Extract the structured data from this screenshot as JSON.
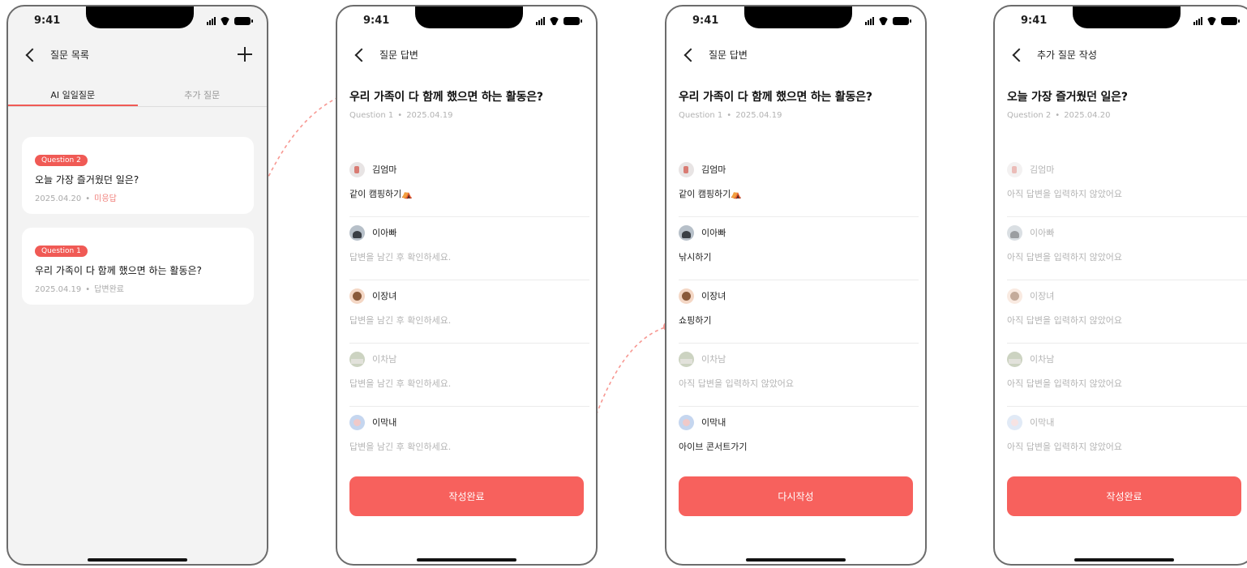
{
  "status": {
    "time": "9:41"
  },
  "screen1": {
    "nav_title": "질문 목록",
    "tabs": [
      "AI 일일질문",
      "추가 질문"
    ],
    "cards": [
      {
        "badge": "Question 2",
        "question": "오늘 가장 즐거웠던 일은?",
        "date": "2025.04.20",
        "dot": "•",
        "state": "미응답"
      },
      {
        "badge": "Question 1",
        "question": "우리 가족이 다 함께 했으면 하는 활동은?",
        "date": "2025.04.19",
        "dot": "•",
        "state": "답변완료"
      }
    ]
  },
  "screen2": {
    "nav_title": "질문 답변",
    "title": "우리 가족이 다 함께 했으면 하는 활동은?",
    "sub_label": "Question 1",
    "dot": "•",
    "sub_date": "2025.04.19",
    "answers": [
      {
        "name": "김엄마",
        "text": "같이 캠핑하기⛺"
      },
      {
        "name": "이아빠",
        "text": "답변을 남긴 후 확인하세요."
      },
      {
        "name": "이장녀",
        "text": "답변을 남긴 후 확인하세요."
      },
      {
        "name": "이차남",
        "text": "답변을 남긴 후 확인하세요."
      },
      {
        "name": "이막내",
        "text": "답변을 남긴 후 확인하세요."
      }
    ],
    "button": "작성완료"
  },
  "screen3": {
    "nav_title": "질문 답변",
    "title": "우리 가족이 다 함께 했으면 하는 활동은?",
    "sub_label": "Question 1",
    "dot": "•",
    "sub_date": "2025.04.19",
    "answers": [
      {
        "name": "김엄마",
        "text": "같이 캠핑하기⛺"
      },
      {
        "name": "이아빠",
        "text": "낚시하기"
      },
      {
        "name": "이장녀",
        "text": "쇼핑하기"
      },
      {
        "name": "이차남",
        "text": "아직 답변을 입력하지 않았어요"
      },
      {
        "name": "이막내",
        "text": "아이브 콘서트가기"
      }
    ],
    "button": "다시작성"
  },
  "screen4": {
    "nav_title": "추가 질문 작성",
    "title": "오늘 가장 즐거웠던 일은?",
    "sub_label": "Question 2",
    "dot": "•",
    "sub_date": "2025.04.20",
    "answers": [
      {
        "name": "김엄마",
        "text": "아직 답변을 입력하지 않았어요"
      },
      {
        "name": "이아빠",
        "text": "아직 답변을 입력하지 않았어요"
      },
      {
        "name": "이장녀",
        "text": "아직 답변을 입력하지 않았어요"
      },
      {
        "name": "이차남",
        "text": "아직 답변을 입력하지 않았어요"
      },
      {
        "name": "이막내",
        "text": "아직 답변을 입력하지 않았어요"
      }
    ],
    "button": "작성완료"
  },
  "colors": {
    "accent": "#f7615d",
    "badge": "#f05a55",
    "connector": "#f79791"
  },
  "icons": [
    "back-chevron-icon",
    "plus-icon",
    "signal-icon",
    "wifi-icon",
    "battery-icon"
  ]
}
